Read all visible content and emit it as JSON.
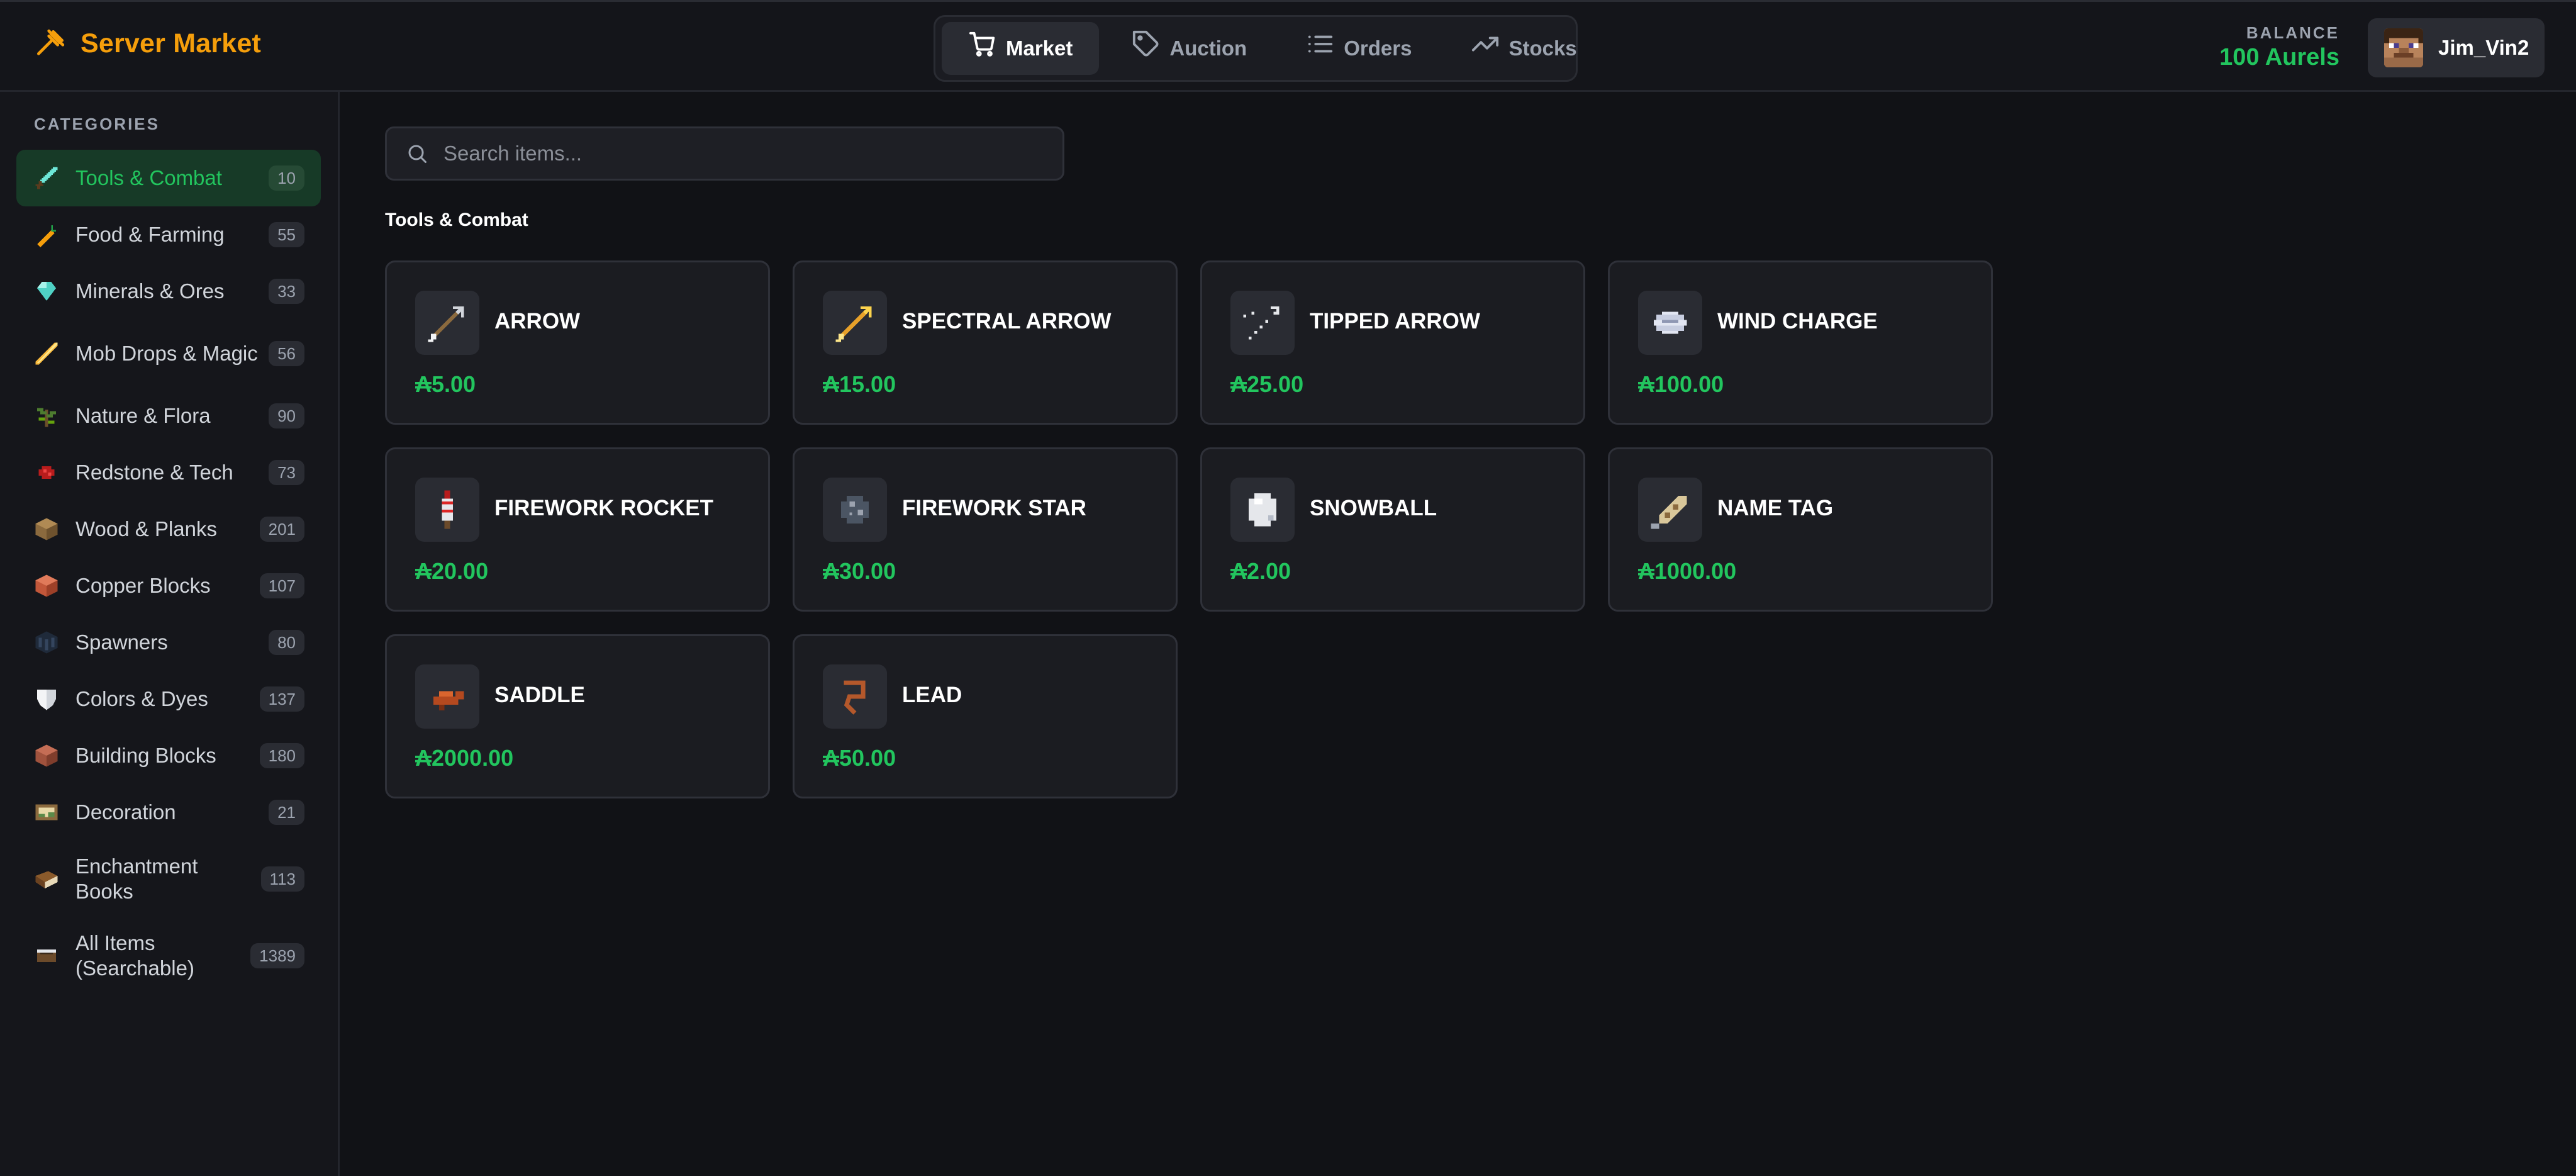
{
  "app": {
    "title": "Server Market"
  },
  "nav": {
    "tabs": [
      {
        "label": "Market",
        "icon": "cart-icon",
        "active": true
      },
      {
        "label": "Auction",
        "icon": "tag-icon",
        "active": false
      },
      {
        "label": "Orders",
        "icon": "list-icon",
        "active": false
      },
      {
        "label": "Stocks",
        "icon": "trending-up-icon",
        "active": false
      }
    ]
  },
  "balance": {
    "label": "BALANCE",
    "value": "100 Aurels"
  },
  "user": {
    "name": "Jim_Vin2"
  },
  "sidebar": {
    "heading": "CATEGORIES",
    "items": [
      {
        "label": "Tools & Combat",
        "count": "10",
        "icon": "sword-icon",
        "active": true
      },
      {
        "label": "Food & Farming",
        "count": "55",
        "icon": "carrot-icon",
        "active": false
      },
      {
        "label": "Minerals & Ores",
        "count": "33",
        "icon": "diamond-icon",
        "active": false
      },
      {
        "label": "Mob Drops & Magic",
        "count": "56",
        "icon": "blaze-rod-icon",
        "active": false
      },
      {
        "label": "Nature & Flora",
        "count": "90",
        "icon": "plant-icon",
        "active": false
      },
      {
        "label": "Redstone & Tech",
        "count": "73",
        "icon": "redstone-icon",
        "active": false
      },
      {
        "label": "Wood & Planks",
        "count": "201",
        "icon": "wood-block-icon",
        "active": false
      },
      {
        "label": "Copper Blocks",
        "count": "107",
        "icon": "copper-block-icon",
        "active": false
      },
      {
        "label": "Spawners",
        "count": "80",
        "icon": "spawner-icon",
        "active": false
      },
      {
        "label": "Colors & Dyes",
        "count": "137",
        "icon": "shield-icon",
        "active": false
      },
      {
        "label": "Building Blocks",
        "count": "180",
        "icon": "brick-block-icon",
        "active": false
      },
      {
        "label": "Decoration",
        "count": "21",
        "icon": "painting-icon",
        "active": false
      },
      {
        "label": "Enchantment Books",
        "count": "113",
        "icon": "book-icon",
        "active": false
      },
      {
        "label": "All Items (Searchable)",
        "count": "1389",
        "icon": "barrel-icon",
        "active": false
      }
    ]
  },
  "search": {
    "placeholder": "Search items...",
    "value": ""
  },
  "section": {
    "title": "Tools & Combat"
  },
  "items": [
    {
      "name": "ARROW",
      "price": "₳5.00",
      "icon": "arrow-icon"
    },
    {
      "name": "SPECTRAL ARROW",
      "price": "₳15.00",
      "icon": "spectral-arrow-icon"
    },
    {
      "name": "TIPPED ARROW",
      "price": "₳25.00",
      "icon": "tipped-arrow-icon"
    },
    {
      "name": "WIND CHARGE",
      "price": "₳100.00",
      "icon": "wind-charge-icon"
    },
    {
      "name": "FIREWORK ROCKET",
      "price": "₳20.00",
      "icon": "firework-rocket-icon"
    },
    {
      "name": "FIREWORK STAR",
      "price": "₳30.00",
      "icon": "firework-star-icon"
    },
    {
      "name": "SNOWBALL",
      "price": "₳2.00",
      "icon": "snowball-icon"
    },
    {
      "name": "NAME TAG",
      "price": "₳1000.00",
      "icon": "name-tag-icon"
    },
    {
      "name": "SADDLE",
      "price": "₳2000.00",
      "icon": "saddle-icon"
    },
    {
      "name": "LEAD",
      "price": "₳50.00",
      "icon": "lead-icon"
    }
  ],
  "colors": {
    "accent": "#f59e0b",
    "positive": "#22c55e",
    "active_category_bg": "#173a27",
    "background": "#111216"
  }
}
